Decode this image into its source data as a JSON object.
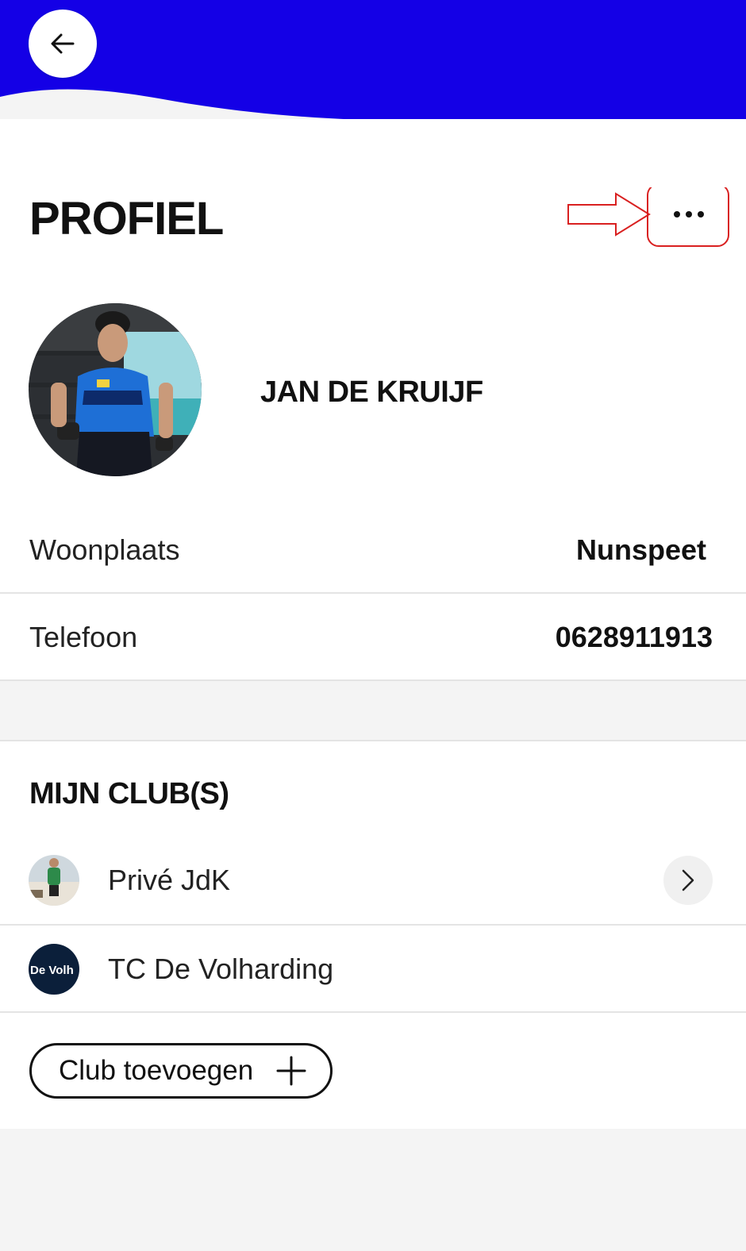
{
  "header": {
    "accent_color": "#1400e6",
    "back_icon": "arrow-left-icon"
  },
  "page": {
    "title": "PROFIEL",
    "more_icon": "more-horizontal-icon"
  },
  "profile": {
    "name": "JAN DE KRUIJF",
    "fields": [
      {
        "label": "Woonplaats",
        "value": "Nunspeet"
      },
      {
        "label": "Telefoon",
        "value": "0628911913"
      }
    ]
  },
  "clubs": {
    "title": "MIJN CLUB(S)",
    "items": [
      {
        "name": "Privé JdK",
        "has_chevron": true
      },
      {
        "name": "TC De Volharding",
        "has_chevron": false,
        "logo_text": "De Volh"
      }
    ],
    "add_label": "Club toevoegen"
  }
}
